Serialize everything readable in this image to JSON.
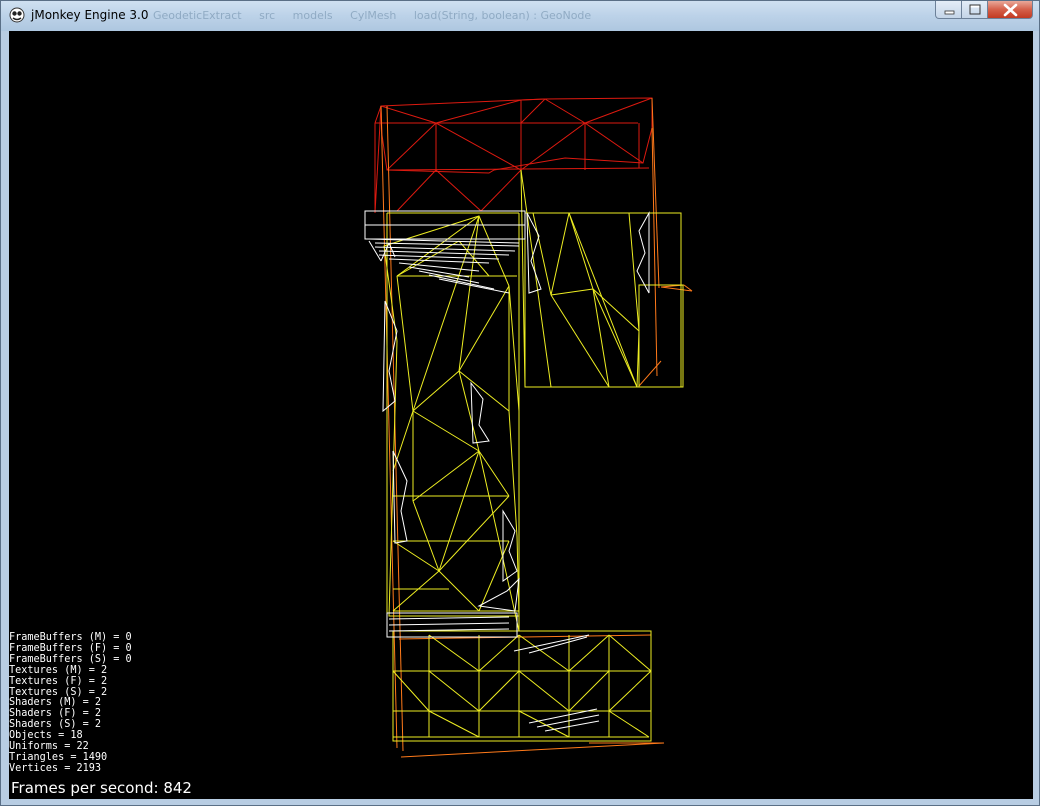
{
  "window": {
    "title": "jMonkey Engine 3.0",
    "background_breadcrumbs": [
      "GeodeticExtract",
      "src",
      "models",
      "CylMesh",
      "load(String, boolean) : GeoNode"
    ]
  },
  "stats": [
    {
      "label": "FrameBuffers (M)",
      "value": "0"
    },
    {
      "label": "FrameBuffers (F)",
      "value": "0"
    },
    {
      "label": "FrameBuffers (S)",
      "value": "0"
    },
    {
      "label": "Textures (M)",
      "value": "2"
    },
    {
      "label": "Textures (F)",
      "value": "2"
    },
    {
      "label": "Textures (S)",
      "value": "2"
    },
    {
      "label": "Shaders (M)",
      "value": "2"
    },
    {
      "label": "Shaders (F)",
      "value": "2"
    },
    {
      "label": "Shaders (S)",
      "value": "2"
    },
    {
      "label": "Objects",
      "value": "18"
    },
    {
      "label": "Uniforms",
      "value": "22"
    },
    {
      "label": "Triangles",
      "value": "1490"
    },
    {
      "label": "Vertices",
      "value": "2193"
    }
  ],
  "fps": {
    "label": "Frames per second:",
    "value": "842"
  },
  "colors": {
    "wire_red": "#dd1a10",
    "wire_orange": "#ff7a1a",
    "wire_yellow": "#eeee22",
    "wire_white": "#ffffff",
    "background": "#000000"
  },
  "icons": {
    "app": "jmonkey-logo-icon",
    "minimize": "minimize-icon",
    "maximize": "maximize-icon",
    "close": "close-icon"
  }
}
